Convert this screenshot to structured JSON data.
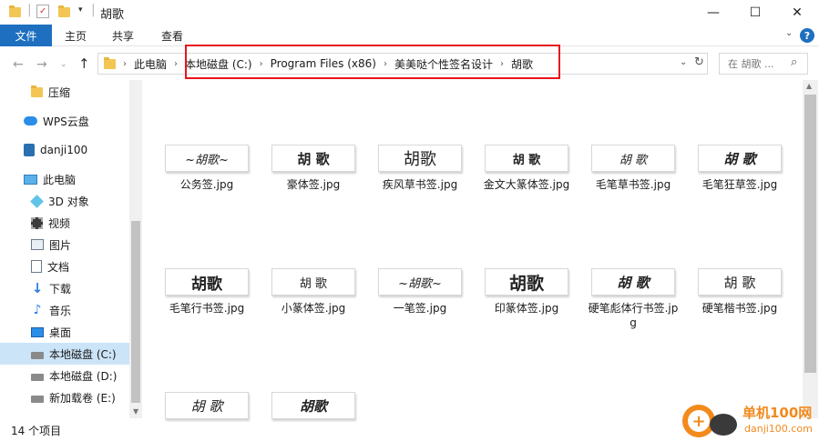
{
  "window": {
    "title": "胡歌",
    "minimize_icon": "—",
    "maximize_icon": "☐",
    "close_icon": "✕"
  },
  "ribbon": {
    "tabs": [
      "文件",
      "主页",
      "共享",
      "查看"
    ],
    "collapse_icon": "chevron-down-icon",
    "help_icon": "?"
  },
  "address": {
    "crumbs": [
      "此电脑",
      "本地磁盘 (C:)",
      "Program Files (x86)",
      "美美哒个性签名设计",
      "胡歌"
    ],
    "search_placeholder": "在 胡歌 ...",
    "highlight_color": "#e8141c"
  },
  "sidebar": {
    "items": [
      {
        "label": "压缩",
        "icon": "folder-icon"
      },
      {
        "label": "WPS云盘",
        "icon": "cloud-icon"
      },
      {
        "label": "danji100",
        "icon": "user-icon"
      },
      {
        "label": "此电脑",
        "icon": "computer-icon"
      },
      {
        "label": "3D 对象",
        "icon": "cube-icon"
      },
      {
        "label": "视频",
        "icon": "video-icon"
      },
      {
        "label": "图片",
        "icon": "picture-icon"
      },
      {
        "label": "文档",
        "icon": "document-icon"
      },
      {
        "label": "下载",
        "icon": "download-icon"
      },
      {
        "label": "音乐",
        "icon": "music-icon"
      },
      {
        "label": "桌面",
        "icon": "desktop-icon"
      },
      {
        "label": "本地磁盘 (C:)",
        "icon": "drive-icon",
        "selected": true
      },
      {
        "label": "本地磁盘 (D:)",
        "icon": "drive-icon"
      },
      {
        "label": "新加载卷 (E:)",
        "icon": "drive-icon"
      }
    ]
  },
  "files": [
    {
      "name": "公务签.jpg",
      "sig": "~胡歌~"
    },
    {
      "name": "豪体签.jpg",
      "sig": "胡 歌"
    },
    {
      "name": "疾风草书签.jpg",
      "sig": "胡歌"
    },
    {
      "name": "金文大篆体签.jpg",
      "sig": "胡 歌"
    },
    {
      "name": "毛笔草书签.jpg",
      "sig": "胡 歌"
    },
    {
      "name": "毛笔狂草签.jpg",
      "sig": "胡 歌"
    },
    {
      "name": "毛笔行书签.jpg",
      "sig": "胡歌"
    },
    {
      "name": "小篆体签.jpg",
      "sig": "胡 歌"
    },
    {
      "name": "一笔签.jpg",
      "sig": "~胡歌~"
    },
    {
      "name": "印篆体签.jpg",
      "sig": "胡歌"
    },
    {
      "name": "硬笔彪体行书签.jpg",
      "sig": "胡 歌"
    },
    {
      "name": "硬笔楷书签.jpg",
      "sig": "胡 歌"
    },
    {
      "name": "",
      "sig": "胡 歌"
    },
    {
      "name": "",
      "sig": "胡歌"
    }
  ],
  "status": {
    "count": "14 个项目"
  },
  "watermark": {
    "brand": "单机100网",
    "url": "danji100.com"
  }
}
